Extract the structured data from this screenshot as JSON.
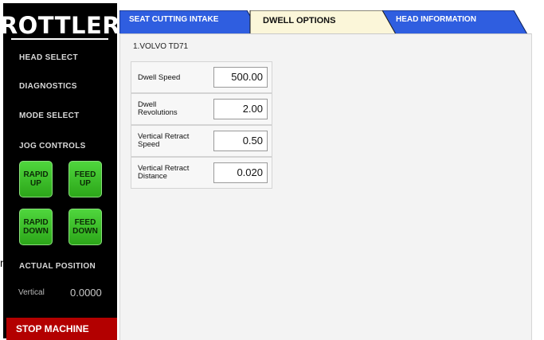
{
  "sidebar": {
    "logo": "ROTTLER",
    "head_select": "HEAD SELECT",
    "diagnostics": "DIAGNOSTICS",
    "mode_select": "MODE SELECT",
    "jog_controls": "JOG CONTROLS",
    "rapid_up": "RAPID UP",
    "feed_up": "FEED UP",
    "rapid_down": "RAPID DOWN",
    "feed_down": "FEED DOWN",
    "actual_position": "ACTUAL POSITION",
    "vertical_label": "Vertical",
    "vertical_value": "0.0000",
    "stop_machine": "STOP MACHINE"
  },
  "stray_text": "m",
  "tabs": [
    {
      "label": "SEAT CUTTING INTAKE",
      "active": false
    },
    {
      "label": "DWELL OPTIONS",
      "active": true
    },
    {
      "label": "HEAD INFORMATION",
      "active": false
    }
  ],
  "main": {
    "model": "1.VOLVO TD71",
    "params": [
      {
        "label": "Dwell Speed",
        "value": "500.00"
      },
      {
        "label": "Dwell Revolutions",
        "value": "2.00"
      },
      {
        "label": "Vertical Retract Speed",
        "value": "0.50"
      },
      {
        "label": "Vertical Retract Distance",
        "value": "0.020"
      }
    ]
  },
  "colors": {
    "sidebar_bg": "#000000",
    "jog_green": "#3cc22a",
    "stop_red": "#b30000",
    "tab_blue": "#2f5ee0",
    "tab_active": "#fbf6d9"
  }
}
